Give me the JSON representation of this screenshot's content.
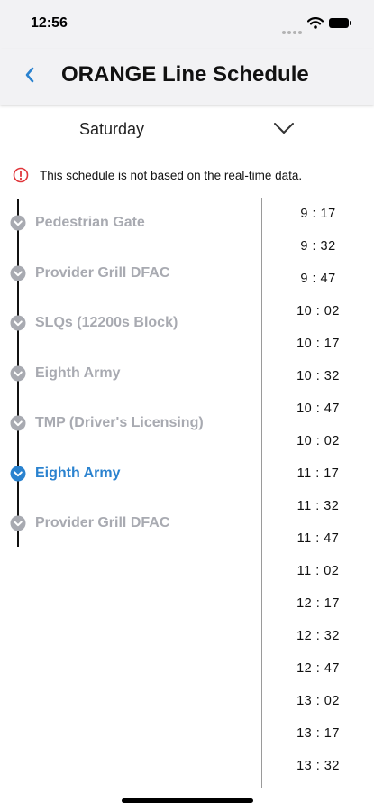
{
  "status": {
    "time": "12:56"
  },
  "header": {
    "title": "ORANGE Line Schedule"
  },
  "day_selector": {
    "selected": "Saturday"
  },
  "notice": {
    "text": "This schedule is not based on the real-time data."
  },
  "stops": [
    {
      "name": "Pedestrian Gate",
      "active": false
    },
    {
      "name": "Provider Grill DFAC",
      "active": false
    },
    {
      "name": "SLQs (12200s Block)",
      "active": false
    },
    {
      "name": "Eighth Army",
      "active": false
    },
    {
      "name": "TMP (Driver's Licensing)",
      "active": false
    },
    {
      "name": "Eighth Army",
      "active": true
    },
    {
      "name": "Provider Grill DFAC",
      "active": false
    }
  ],
  "times": [
    "9 : 17",
    "9 : 32",
    "9 : 47",
    "10 : 02",
    "10 : 17",
    "10 : 32",
    "10 : 47",
    "10 : 02",
    "11 : 17",
    "11 : 32",
    "11 : 47",
    "11 : 02",
    "12 : 17",
    "12 : 32",
    "12 : 47",
    "13 : 02",
    "13 : 17",
    "13 : 32"
  ],
  "colors": {
    "accent": "#2a82cf",
    "inactive": "#a8aab1",
    "warning": "#e0353a"
  }
}
